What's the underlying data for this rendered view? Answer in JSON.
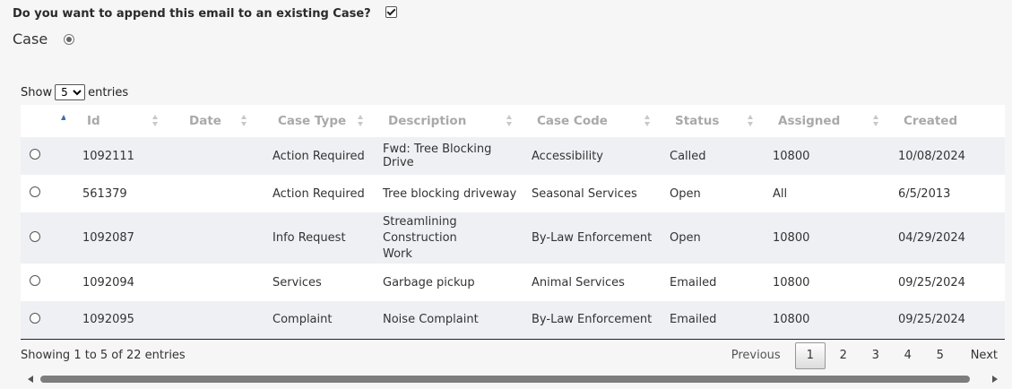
{
  "form": {
    "append_question": "Do you want to append this email to an existing Case?",
    "append_checked": true,
    "case_label": "Case"
  },
  "length": {
    "show_label": "Show",
    "selected": "5",
    "entries_label": "entries"
  },
  "table": {
    "headers": [
      "Id",
      "Date",
      "Case Type",
      "Description",
      "Case Code",
      "Status",
      "Assigned",
      "Created"
    ],
    "rows": [
      {
        "id": "1092111",
        "date": "",
        "case_type": "Action Required",
        "description": "Fwd: Tree Blocking Drive",
        "case_code": "Accessibility",
        "status": "Called",
        "assigned": "10800",
        "created": "10/08/2024"
      },
      {
        "id": "561379",
        "date": "",
        "case_type": "Action Required",
        "description": "Tree blocking driveway",
        "case_code": "Seasonal Services",
        "status": "Open",
        "assigned": "All",
        "created": "6/5/2013"
      },
      {
        "id": "1092087",
        "date": "",
        "case_type": "Info Request",
        "description": "Streamlining Construction Work",
        "case_code": "By-Law Enforcement",
        "status": "Open",
        "assigned": "10800",
        "created": "04/29/2024"
      },
      {
        "id": "1092094",
        "date": "",
        "case_type": "Services",
        "description": "Garbage pickup",
        "case_code": "Animal Services",
        "status": "Emailed",
        "assigned": "10800",
        "created": "09/25/2024"
      },
      {
        "id": "1092095",
        "date": "",
        "case_type": "Complaint",
        "description": "Noise Complaint",
        "case_code": "By-Law Enforcement",
        "status": "Emailed",
        "assigned": "10800",
        "created": "09/25/2024"
      }
    ]
  },
  "info": "Showing 1 to 5 of 22 entries",
  "pagination": {
    "previous": "Previous",
    "pages": [
      "1",
      "2",
      "3",
      "4",
      "5"
    ],
    "current": "1",
    "next": "Next"
  }
}
